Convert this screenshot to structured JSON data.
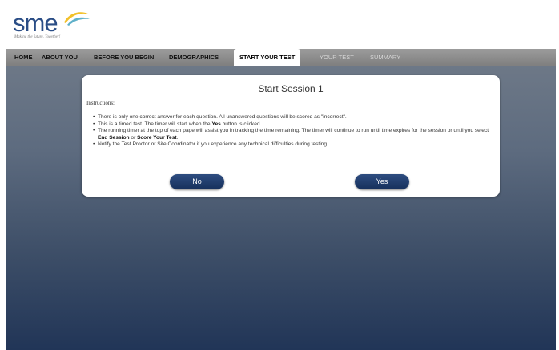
{
  "brand": {
    "logo_text": "sme",
    "tagline": "Making the future. Together!",
    "colors": {
      "blue": "#2a4d86",
      "yellow": "#f2c029",
      "teal": "#5fb0c9"
    }
  },
  "nav": {
    "items": [
      {
        "label": "HOME",
        "state": "normal"
      },
      {
        "label": "ABOUT YOU",
        "state": "normal"
      },
      {
        "label": "BEFORE YOU BEGIN",
        "state": "normal"
      },
      {
        "label": "DEMOGRAPHICS",
        "state": "normal"
      },
      {
        "label": "START YOUR TEST",
        "state": "active"
      },
      {
        "label": "YOUR TEST",
        "state": "disabled"
      },
      {
        "label": "SUMMARY",
        "state": "disabled"
      }
    ]
  },
  "dialog": {
    "title": "Start Session 1",
    "instructions_label": "Instructions:",
    "bullets": [
      {
        "parts": [
          {
            "text": "There is only one correct answer for each question. All unanswered questions will be scored as \"incorrect\".",
            "bold": false
          }
        ]
      },
      {
        "parts": [
          {
            "text": "This is a timed test. The timer will start when the ",
            "bold": false
          },
          {
            "text": "Yes",
            "bold": true
          },
          {
            "text": " button is clicked.",
            "bold": false
          }
        ]
      },
      {
        "parts": [
          {
            "text": "The running timer at the top of each page will assist you in tracking the time remaining. The timer will continue to run until time expires for the session or until you select ",
            "bold": false
          },
          {
            "text": "End Session",
            "bold": true
          },
          {
            "text": " or ",
            "bold": false
          },
          {
            "text": "Score Your Test",
            "bold": true
          },
          {
            "text": ".",
            "bold": false
          }
        ]
      },
      {
        "parts": [
          {
            "text": "Notify the Test Proctor or Site Coordinator if you experience any technical difficulties during testing.",
            "bold": false
          }
        ]
      }
    ],
    "no_label": "No",
    "yes_label": "Yes"
  }
}
